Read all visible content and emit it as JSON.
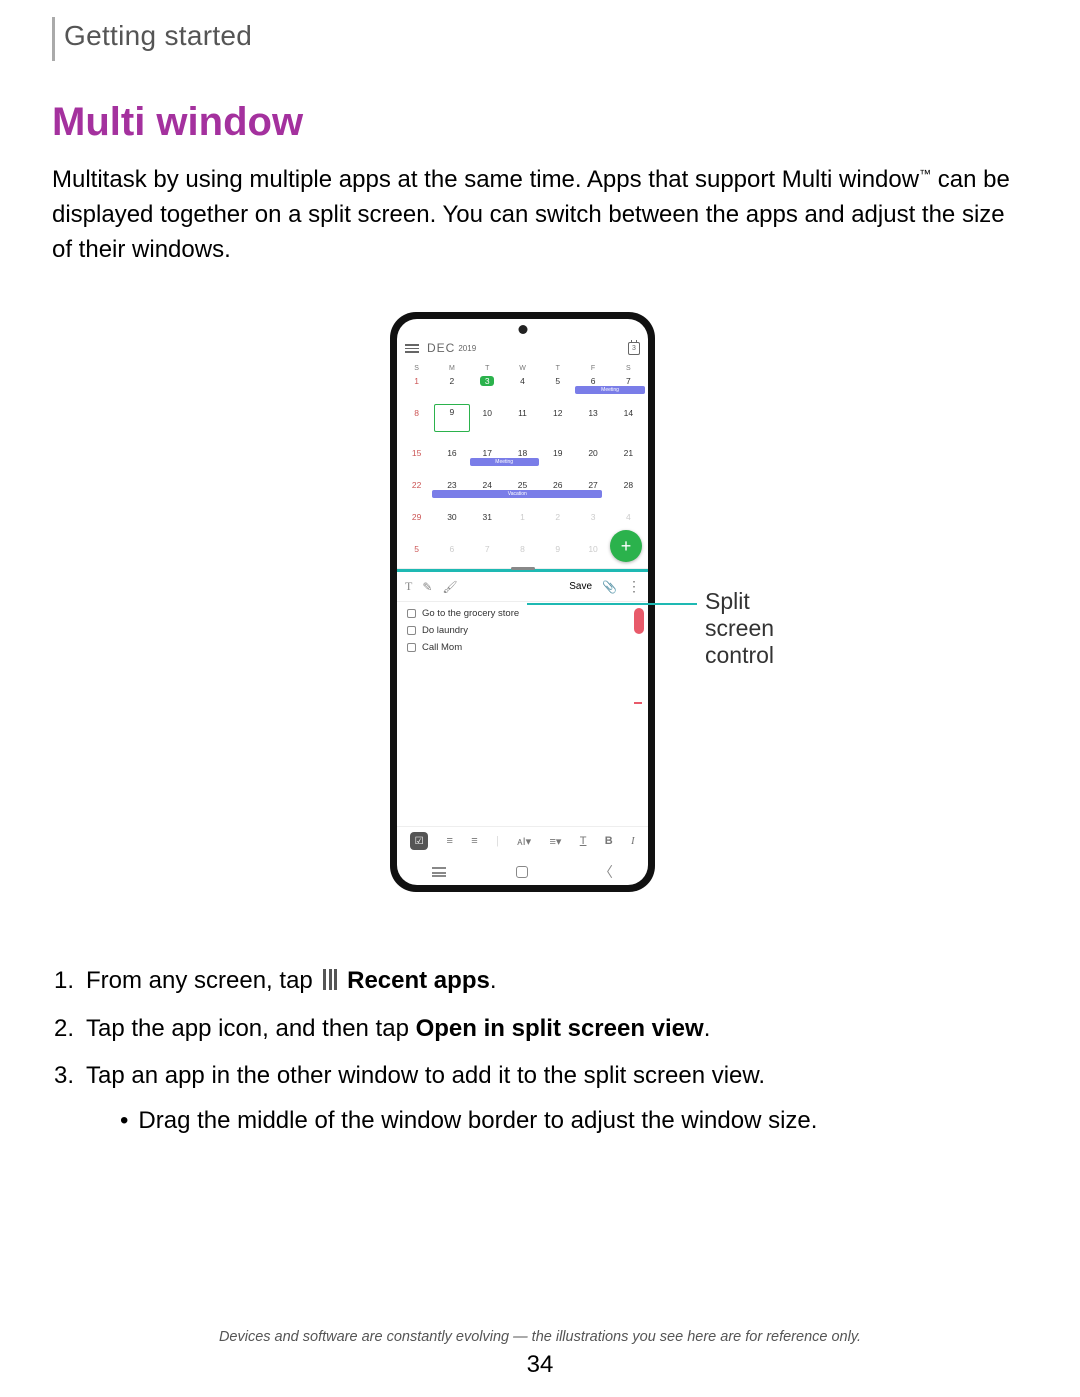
{
  "section": "Getting started",
  "title": "Multi window",
  "intro_a": "Multitask by using multiple apps at the same time. Apps that support Multi window",
  "intro_tm": "™",
  "intro_b": " can be displayed together on a split screen. You can switch between the apps and adjust the size of their windows.",
  "callout": "Split screen control",
  "phone": {
    "month": "DEC",
    "year": "2019",
    "today_badge": "3",
    "dow": [
      "S",
      "M",
      "T",
      "W",
      "T",
      "F",
      "S"
    ],
    "events": {
      "meeting": "Meeting",
      "vacation": "Vacation"
    },
    "notes_toolbar": {
      "t": "T",
      "save": "Save"
    },
    "tasks": [
      "Go to the grocery store",
      "Do laundry",
      "Call Mom"
    ],
    "fmt": {
      "bold": "B",
      "italic": "I",
      "underline": "T"
    }
  },
  "steps": {
    "s1a": "From any screen, tap",
    "s1b": "Recent apps",
    "s1c": ".",
    "s2a": "Tap the app icon, and then tap ",
    "s2b": "Open in split screen view",
    "s2c": ".",
    "s3": "Tap an app in the other window to add it to the split screen view.",
    "s3sub": "Drag the middle of the window border to adjust the window size."
  },
  "footnote": "Devices and software are constantly evolving — the illustrations you see here are for reference only.",
  "page": "34"
}
